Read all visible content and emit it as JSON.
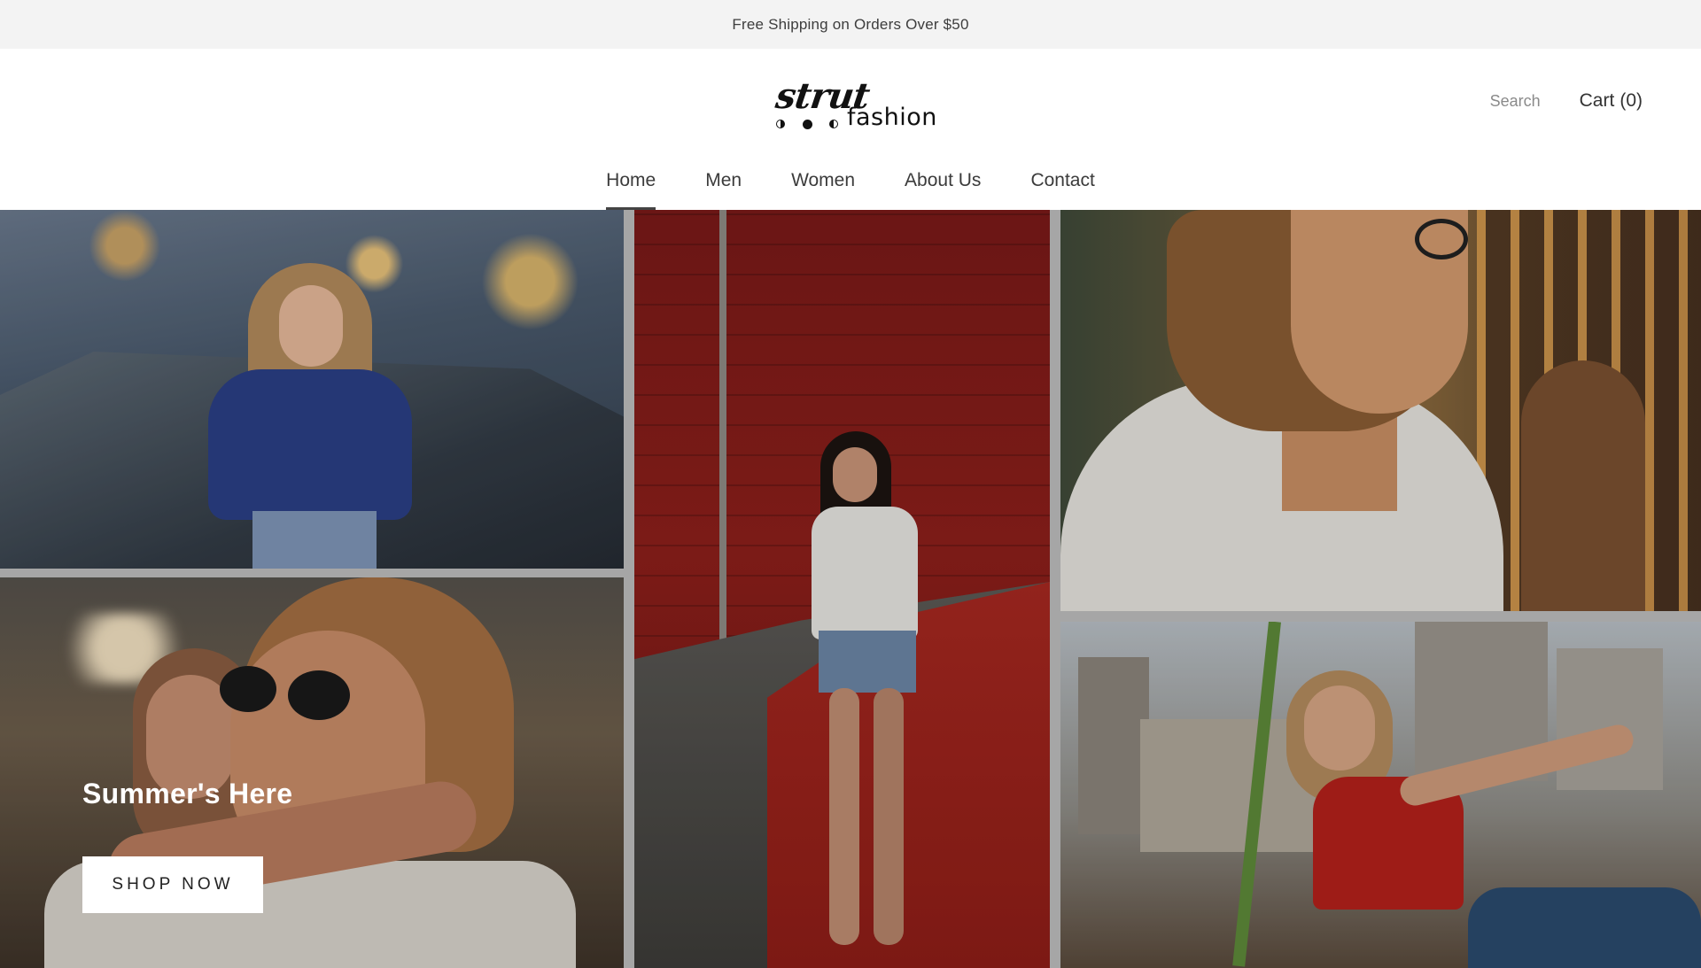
{
  "announcement": {
    "text": "Free Shipping on Orders Over $50"
  },
  "header": {
    "logo_script": "strut",
    "logo_word": "fashion",
    "search_label": "Search",
    "cart_label": "Cart",
    "cart_count": "(0)"
  },
  "nav": {
    "items": [
      {
        "label": "Home",
        "active": true
      },
      {
        "label": "Men"
      },
      {
        "label": "Women"
      },
      {
        "label": "About Us"
      },
      {
        "label": "Contact"
      }
    ]
  },
  "hero": {
    "title": "Summer's Here",
    "cta_label": "SHOP NOW"
  },
  "colors": {
    "announcement_bg": "#f3f3f3",
    "text_primary": "#333333",
    "button_bg": "#ffffff"
  }
}
